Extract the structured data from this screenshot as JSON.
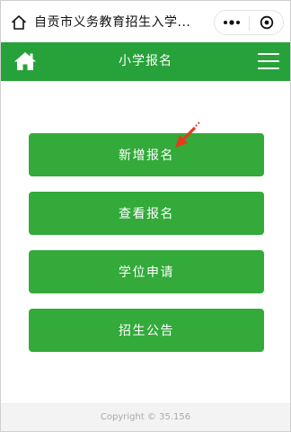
{
  "wechat_bar": {
    "title": "自贡市义务教育招生入学...",
    "home_icon": "house-outline-icon",
    "more_icon": "three-dots-icon",
    "close_icon": "target-circle-icon"
  },
  "header": {
    "title": "小学报名",
    "home_icon": "home-icon",
    "menu_icon": "hamburger-menu-icon",
    "background_color": "#27a23a"
  },
  "buttons": [
    {
      "label": "新增报名"
    },
    {
      "label": "查看报名"
    },
    {
      "label": "学位申请"
    },
    {
      "label": "招生公告"
    }
  ],
  "button_color": "#33aa3a",
  "annotation": {
    "icon": "red-arrow-icon",
    "color": "#e53a1f"
  },
  "footer": {
    "copyright": "Copyright © 35.156"
  }
}
